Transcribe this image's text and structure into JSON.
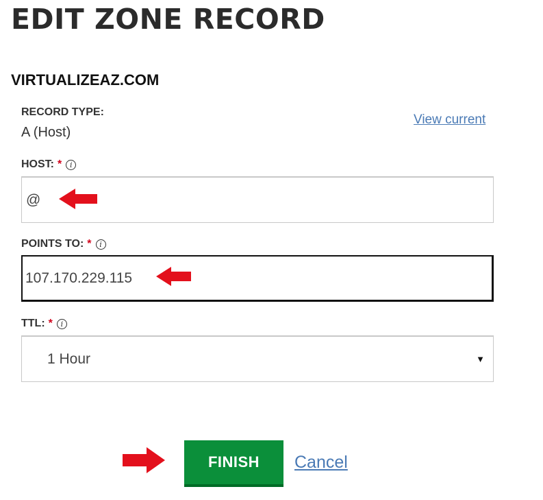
{
  "page": {
    "title": "EDIT ZONE RECORD",
    "domain": "VIRTUALIZEAZ.COM"
  },
  "record_type": {
    "label": "RECORD TYPE:",
    "value": "A (Host)",
    "view_link": "View current"
  },
  "host": {
    "label": "HOST:",
    "required_mark": "*",
    "value": "@"
  },
  "points_to": {
    "label": "POINTS TO:",
    "required_mark": "*",
    "value": "107.170.229.115"
  },
  "ttl": {
    "label": "TTL:",
    "required_mark": "*",
    "selected": "1 Hour"
  },
  "actions": {
    "finish": "FINISH",
    "cancel": "Cancel"
  },
  "colors": {
    "accent_green": "#0b8f3a",
    "link_blue": "#4a7ab5",
    "required_red": "#d0021b",
    "annotation_arrow": "#e3101c"
  },
  "icons": {
    "info": "info-icon",
    "annotation": "red-arrow-icon",
    "dropdown": "caret-down-icon"
  }
}
